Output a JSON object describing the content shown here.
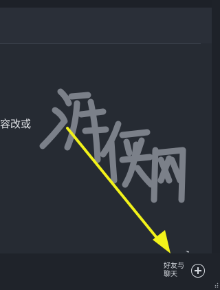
{
  "main": {
    "truncated_text": "容改或"
  },
  "footer": {
    "friends_chat_label": "好友与聊天",
    "friends_chat_icon": "plus-circle-icon"
  },
  "watermark": {
    "text": "游侠网"
  },
  "colors": {
    "background": "#262b33",
    "footer": "#1f232a",
    "text": "#e6e8ec",
    "annotation_arrow": "#f2f21a",
    "watermark": "#8a8f98"
  }
}
